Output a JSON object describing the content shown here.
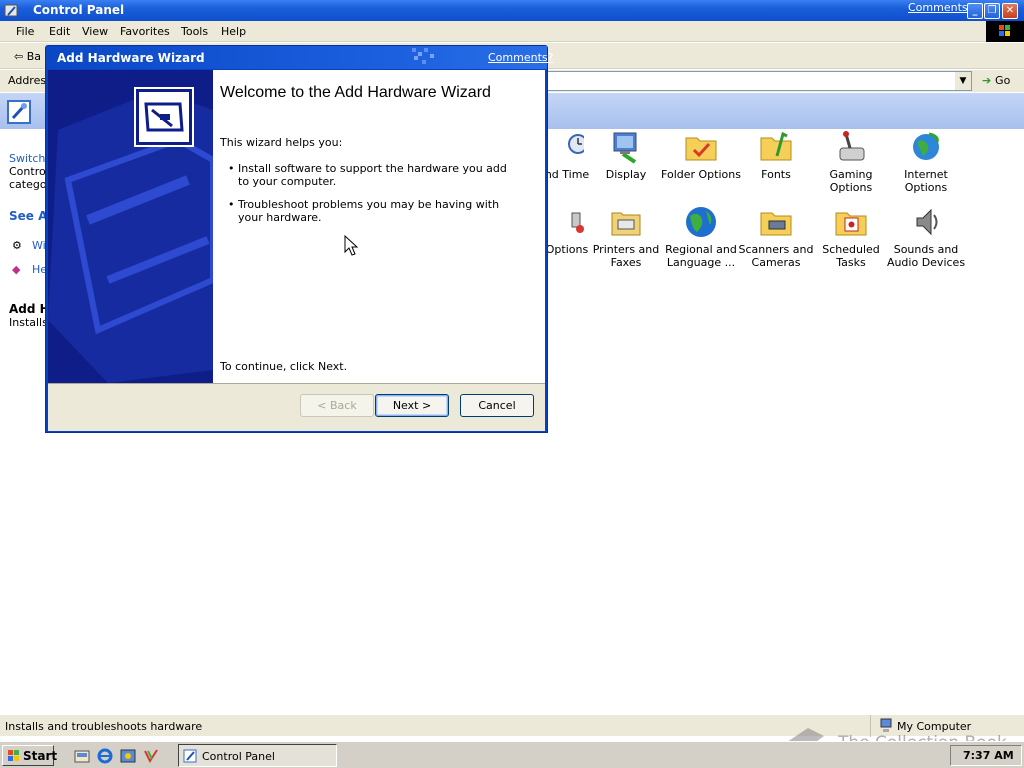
{
  "window": {
    "title": "Control Panel",
    "comments_link": "Comments?",
    "controls": {
      "minimize": "_",
      "restore": "❐",
      "close": "✕"
    }
  },
  "menu": [
    "File",
    "Edit",
    "View",
    "Favorites",
    "Tools",
    "Help"
  ],
  "toolbar": {
    "back_label": "Ba"
  },
  "address": {
    "label": "Addres",
    "go_label": "Go"
  },
  "left_pane": {
    "switch_link": "Switch",
    "switch_line2": "Control",
    "switch_line3": "categor",
    "see_also": "See Al",
    "item1": "Wi",
    "item2": "He",
    "details_title": "Add H",
    "details_desc": "Installs"
  },
  "icons_row1": [
    {
      "label": "nd Time",
      "icon": "clock-icon"
    },
    {
      "label": "Display",
      "icon": "display-icon"
    },
    {
      "label": "Folder Options",
      "icon": "folder-options-icon"
    },
    {
      "label": "Fonts",
      "icon": "fonts-folder-icon"
    },
    {
      "label": "Gaming Options",
      "icon": "gaming-icon"
    },
    {
      "label": "Internet Options",
      "icon": "internet-icon"
    }
  ],
  "icons_row2": [
    {
      "label": "Options",
      "icon": "options-icon"
    },
    {
      "label": "Printers and Faxes",
      "icon": "printer-icon"
    },
    {
      "label": "Regional and Language ...",
      "icon": "globe-icon"
    },
    {
      "label": "Scanners and Cameras",
      "icon": "scanner-icon"
    },
    {
      "label": "Scheduled Tasks",
      "icon": "scheduled-tasks-icon"
    },
    {
      "label": "Sounds and Audio Devices",
      "icon": "speaker-icon"
    }
  ],
  "status": {
    "text": "Installs and troubleshoots hardware",
    "zone": "My Computer"
  },
  "watermark": "The Collection Book",
  "taskbar": {
    "start": "Start",
    "task": "Control Panel",
    "clock": "7:37 AM"
  },
  "wizard": {
    "title": "Add Hardware Wizard",
    "comments": "Comments?",
    "heading": "Welcome to the Add Hardware Wizard",
    "intro": "This wizard helps you:",
    "bullets": [
      "Install software to support the hardware you add to your computer.",
      "Troubleshoot problems you may be having with your hardware."
    ],
    "continue": "To continue, click Next.",
    "back_button": "< Back",
    "next_button": "Next >",
    "cancel_button": "Cancel"
  },
  "colors": {
    "titlebar": "#1a5ed8",
    "wizard_side": "#0e1d88",
    "link": "#215dc6",
    "chrome": "#ece9d8"
  }
}
